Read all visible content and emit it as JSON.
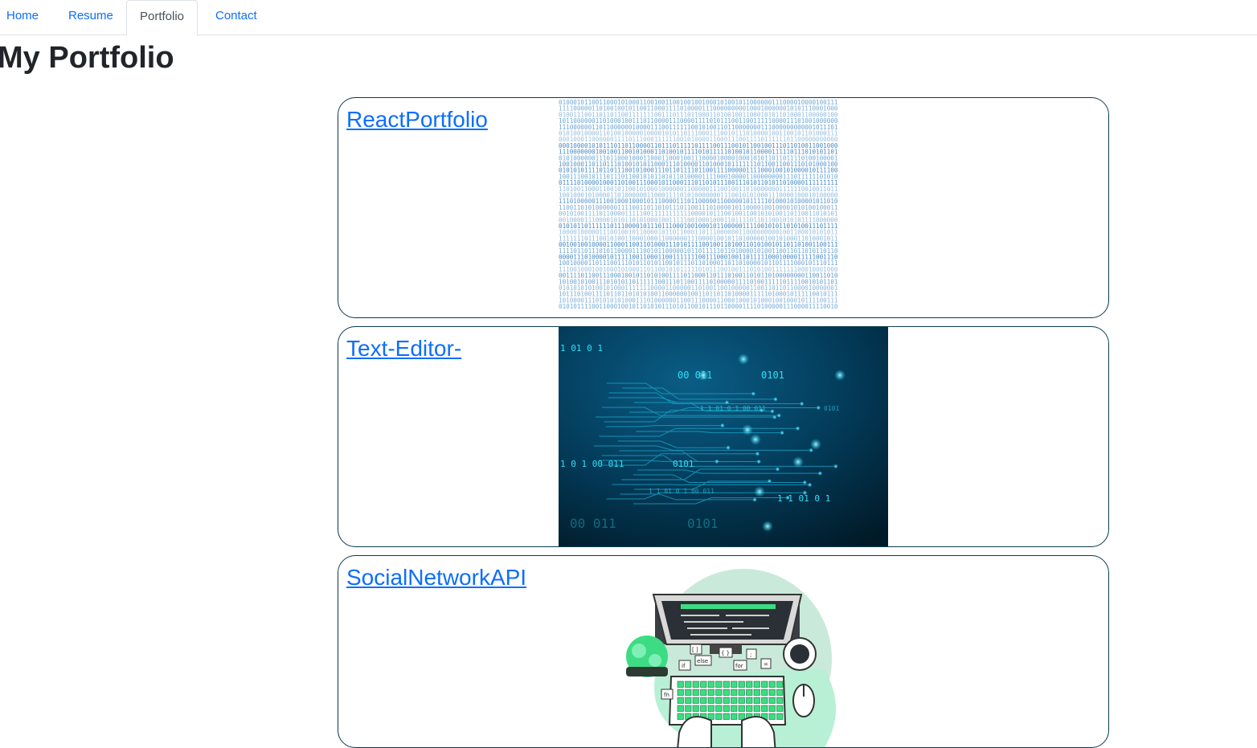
{
  "nav": {
    "items": [
      {
        "label": "Home",
        "active": false
      },
      {
        "label": "Resume",
        "active": false
      },
      {
        "label": "Portfolio",
        "active": true
      },
      {
        "label": "Contact",
        "active": false
      }
    ]
  },
  "page": {
    "title": "My Portfolio"
  },
  "projects": [
    {
      "title": "ReactPortfolio",
      "image_icon": "binary-code-image"
    },
    {
      "title": "Text-Editor-",
      "image_icon": "circuit-board-image"
    },
    {
      "title": "SocialNetworkAPI",
      "image_icon": "developer-laptop-illustration"
    }
  ],
  "image_text": {
    "circuit": {
      "l1": "1   01  0  1",
      "l2": "00  011",
      "l3": "0101",
      "l4": "1 1   01  0  1   00  011",
      "l5": "0101",
      "l6": "1  0  1   00  011",
      "l7": "0101",
      "l8": "1 1   01  0  1   00  011",
      "l9": "1 1     01  0  1",
      "l10": "00  011",
      "l11": "0101"
    },
    "laptop": {
      "k1": "if",
      "k2": "else",
      "k3": "for",
      "k4": "{ }",
      "k5": ";",
      "k6": "=",
      "k7": "[ ]",
      "k8": "fn"
    }
  },
  "colors": {
    "link": "#0d6efd",
    "card_border": "#0b3a4f",
    "circuit_bg": "#022c45",
    "circuit_glow": "#19c6e6",
    "illustration_green": "#3ddc84"
  }
}
